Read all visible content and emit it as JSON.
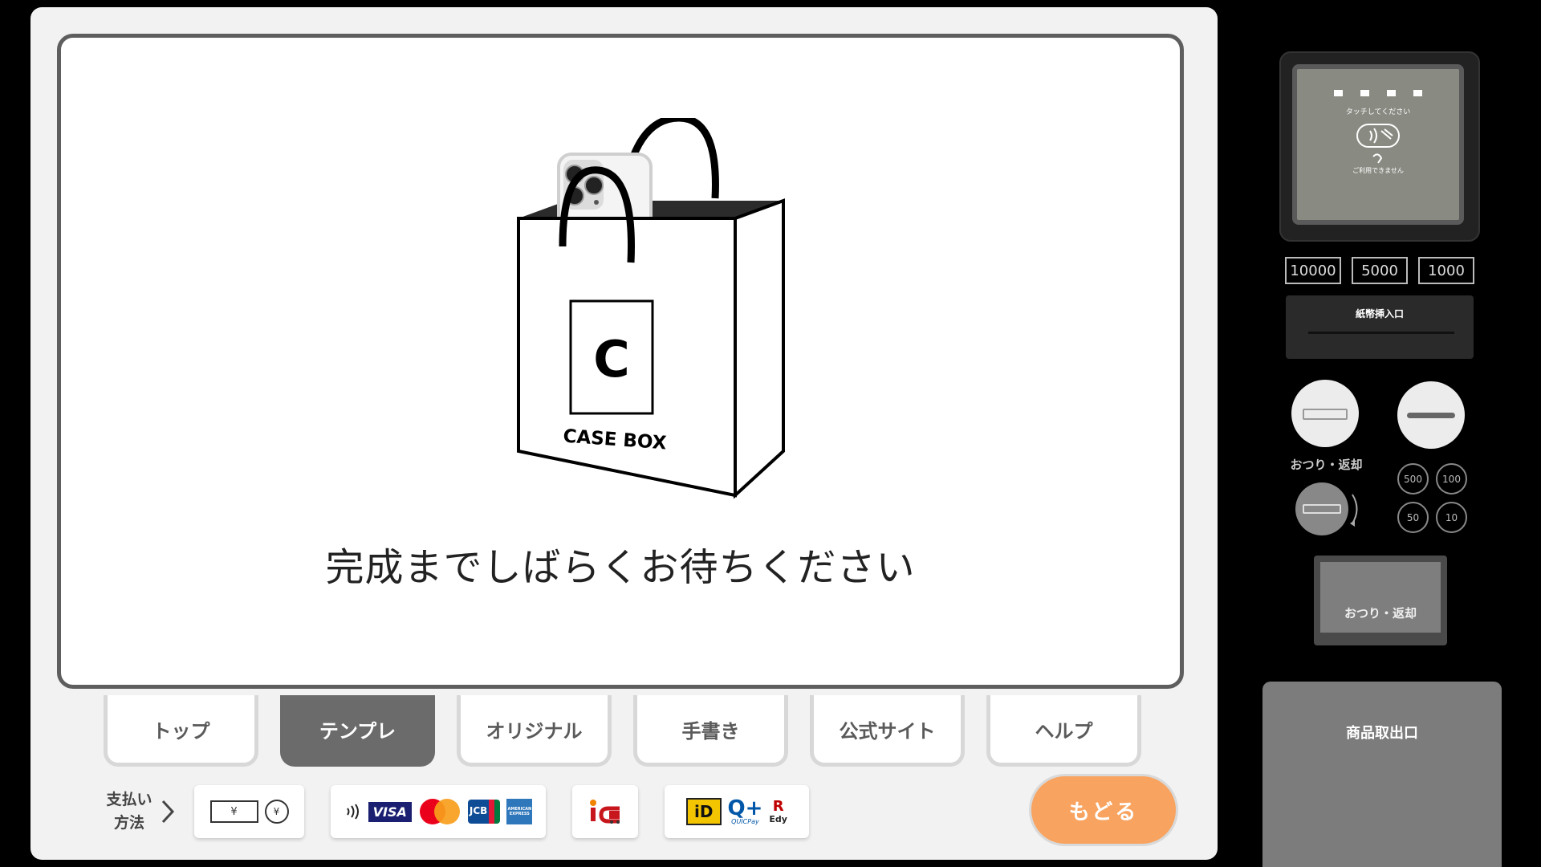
{
  "modal": {
    "message": "完成までしばらくお待ちください",
    "bag_brand_letter": "C",
    "bag_brand_text": "CASE BOX"
  },
  "tabs": [
    {
      "label": "トップ",
      "active": false
    },
    {
      "label": "テンプレ",
      "active": true
    },
    {
      "label": "オリジナル",
      "active": false
    },
    {
      "label": "手書き",
      "active": false
    },
    {
      "label": "公式サイト",
      "active": false
    },
    {
      "label": "ヘルプ",
      "active": false
    }
  ],
  "payment": {
    "label_line1": "支払い",
    "label_line2": "方法",
    "cash_yen": "¥",
    "card_brands": [
      "VISA",
      "JCB",
      "AMERICAN EXPRESS"
    ],
    "emoney": [
      "iD",
      "QUICPay",
      "Edy"
    ],
    "edy_top": "R"
  },
  "back_button": "もどる",
  "hardware": {
    "reader_touch": "タッチしてください",
    "reader_unavailable": "ご利用できません",
    "bills": [
      "10000",
      "5000",
      "1000"
    ],
    "bill_slot": "紙幣挿入口",
    "change_return_label": "おつり・返却",
    "coins": [
      "500",
      "100",
      "50",
      "10"
    ],
    "return_button": "おつり・返却",
    "product_outlet": "商品取出口"
  },
  "colors": {
    "accent": "#f8a35f",
    "active_tab": "#6b6b6b"
  }
}
